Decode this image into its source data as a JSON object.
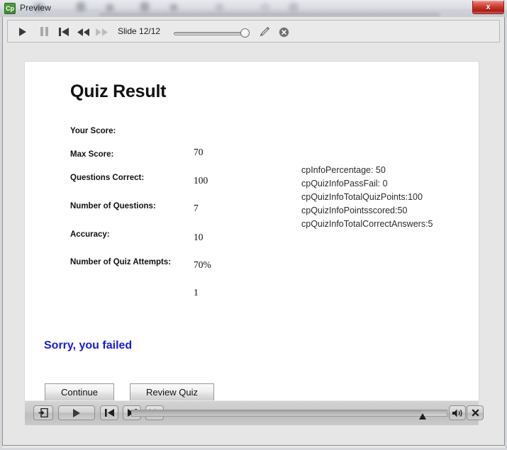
{
  "window": {
    "app_icon": "captivate-cp-icon",
    "title": "Preview",
    "close_label": "x",
    "close_color": "#c9322a"
  },
  "preview_toolbar": {
    "play_icon": "play-icon",
    "pause_icon": "pause-icon",
    "rewind_to_start_icon": "skip-to-start-icon",
    "rewind_icon": "rewind-icon",
    "forward_icon": "fast-forward-icon",
    "slide_indicator": "Slide 12/12",
    "slider_value": 100,
    "pencil_icon": "pencil-icon",
    "stop_icon": "close-circle-icon"
  },
  "slide": {
    "title": "Quiz Result",
    "results": [
      {
        "label": "Your Score:",
        "value": "70"
      },
      {
        "label": "Max Score:",
        "value": "100"
      },
      {
        "label": "Questions Correct:",
        "value": "7"
      },
      {
        "label": "Number of Questions:",
        "value": "10"
      },
      {
        "label": "Accuracy:",
        "value": "70%"
      },
      {
        "label": "Number of Quiz Attempts:",
        "value": "1"
      }
    ],
    "cp_info": "cpInfoPercentage: 50\ncpQuizInfoPassFail: 0\ncpQuizInfoTotalQuizPoints:100\ncpQuizInfoPointsscored:50\ncpQuizInfoTotalCorrectAnswers:5",
    "cp_info_lines": [
      "cpInfoPercentage: 50",
      "cpQuizInfoPassFail: 0",
      "cpQuizInfoTotalQuizPoints:100",
      "cpQuizInfoPointsscored:50",
      "cpQuizInfoTotalCorrectAnswers:5"
    ],
    "verdict": "Sorry, you failed",
    "verdict_color": "#1a1ae0",
    "buttons": {
      "continue": "Continue",
      "review": "Review Quiz"
    }
  },
  "playback_bar": {
    "exit_icon": "exit-icon",
    "play_icon": "play-icon",
    "back_icon": "skip-back-icon",
    "forward_icon": "skip-forward-icon",
    "fast_forward_icon": "fast-forward-icon",
    "progress_percent": 92,
    "audio_icon": "speaker-icon",
    "close_icon": "close-x-icon"
  }
}
